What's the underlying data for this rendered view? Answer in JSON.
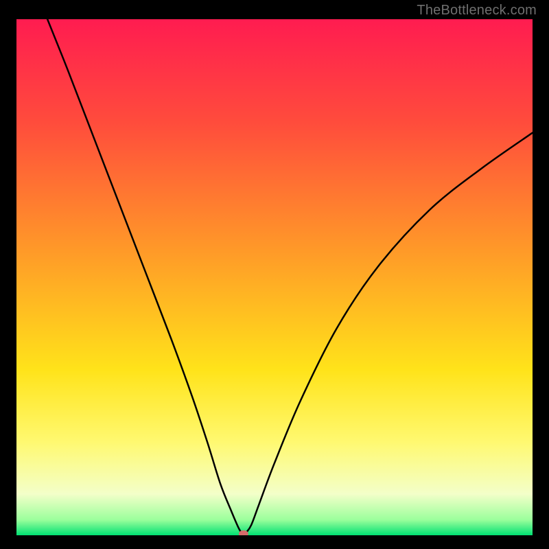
{
  "watermark": "TheBottleneck.com",
  "chart_data": {
    "type": "line",
    "title": "",
    "xlabel": "",
    "ylabel": "",
    "xlim": [
      0,
      100
    ],
    "ylim": [
      0,
      100
    ],
    "grid": false,
    "legend": false,
    "background": {
      "gradient_stops": [
        {
          "position": 0,
          "color": "#ff1c50"
        },
        {
          "position": 20,
          "color": "#ff4c3c"
        },
        {
          "position": 45,
          "color": "#ff9a28"
        },
        {
          "position": 68,
          "color": "#ffe31a"
        },
        {
          "position": 82,
          "color": "#fff971"
        },
        {
          "position": 92,
          "color": "#f3ffc9"
        },
        {
          "position": 97,
          "color": "#9bff9c"
        },
        {
          "position": 100,
          "color": "#00e072"
        }
      ]
    },
    "series": [
      {
        "name": "bottleneck-curve",
        "color": "#000000",
        "x": [
          6,
          10,
          15,
          20,
          25,
          30,
          34,
          37,
          39.5,
          41.5,
          43,
          43.7,
          44.2,
          44.5,
          45.5,
          47,
          50,
          55,
          62,
          70,
          80,
          90,
          100
        ],
        "y": [
          100,
          90,
          77,
          64,
          51,
          38,
          27,
          18,
          10,
          5,
          1.5,
          0.4,
          0.2,
          0.5,
          2,
          6,
          14,
          26,
          40,
          52,
          63,
          71,
          78
        ]
      }
    ],
    "marker": {
      "x": 44,
      "y": 0.3,
      "color": "#d46a6a",
      "rx": 7,
      "ry": 5
    }
  }
}
